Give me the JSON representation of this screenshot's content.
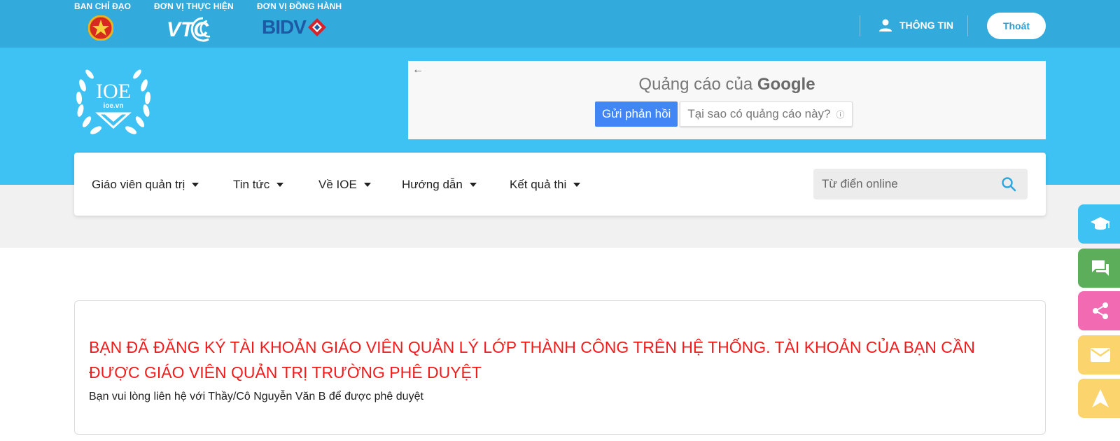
{
  "topbar": {
    "sponsors": [
      {
        "label": "BAN CHỈ ĐẠO",
        "logo": "vietnam-emblem"
      },
      {
        "label": "ĐƠN VỊ THỰC HIỆN",
        "logo": "vtc-logo"
      },
      {
        "label": "ĐƠN VỊ ĐỒNG HÀNH",
        "logo": "bidv-logo"
      }
    ],
    "bidv_text": "BIDV",
    "vtc_text": "VTC",
    "info_label": "THÔNG TIN",
    "logout_label": "Thoát"
  },
  "header": {
    "logo_text": "IOE",
    "logo_sub": "ioe.vn"
  },
  "ad": {
    "back_arrow": "←",
    "title_prefix": "Quảng cáo của",
    "title_brand": "Google",
    "feedback_label": "Gửi phản hồi",
    "why_label": "Tại sao có quảng cáo này?",
    "info_glyph": "ⓘ"
  },
  "nav": {
    "items": [
      {
        "label": "Giáo viên quản trị"
      },
      {
        "label": "Tin tức"
      },
      {
        "label": "Về IOE"
      },
      {
        "label": "Hướng dẫn"
      },
      {
        "label": "Kết quả thi"
      }
    ],
    "search_placeholder": "Từ điển online"
  },
  "message": {
    "title": "BẠN ĐÃ ĐĂNG KÝ TÀI KHOẢN GIÁO VIÊN QUẢN LÝ LỚP THÀNH CÔNG TRÊN HỆ THỐNG. TÀI KHOẢN CỦA BẠN CẦN ĐƯỢC GIÁO VIÊN QUẢN TRỊ TRƯỜNG PHÊ DUYỆT",
    "body": "Bạn vui lòng liên hệ với Thầy/Cô Nguyễn Văn B để được phê duyệt"
  },
  "float_buttons": [
    {
      "icon": "graduation-cap-icon",
      "color": "#3ec1f3"
    },
    {
      "icon": "chat-icon",
      "color": "#5cae5a"
    },
    {
      "icon": "share-icon",
      "color": "#f16ab2"
    },
    {
      "icon": "mail-icon",
      "color": "#fcd46d"
    },
    {
      "icon": "navigate-up-icon",
      "color": "#fcd46d"
    }
  ],
  "colors": {
    "topbar": "#33aadc",
    "header_band": "#3ec1f3",
    "message_red": "#f01b1b",
    "ad_button_blue": "#4286f5"
  }
}
